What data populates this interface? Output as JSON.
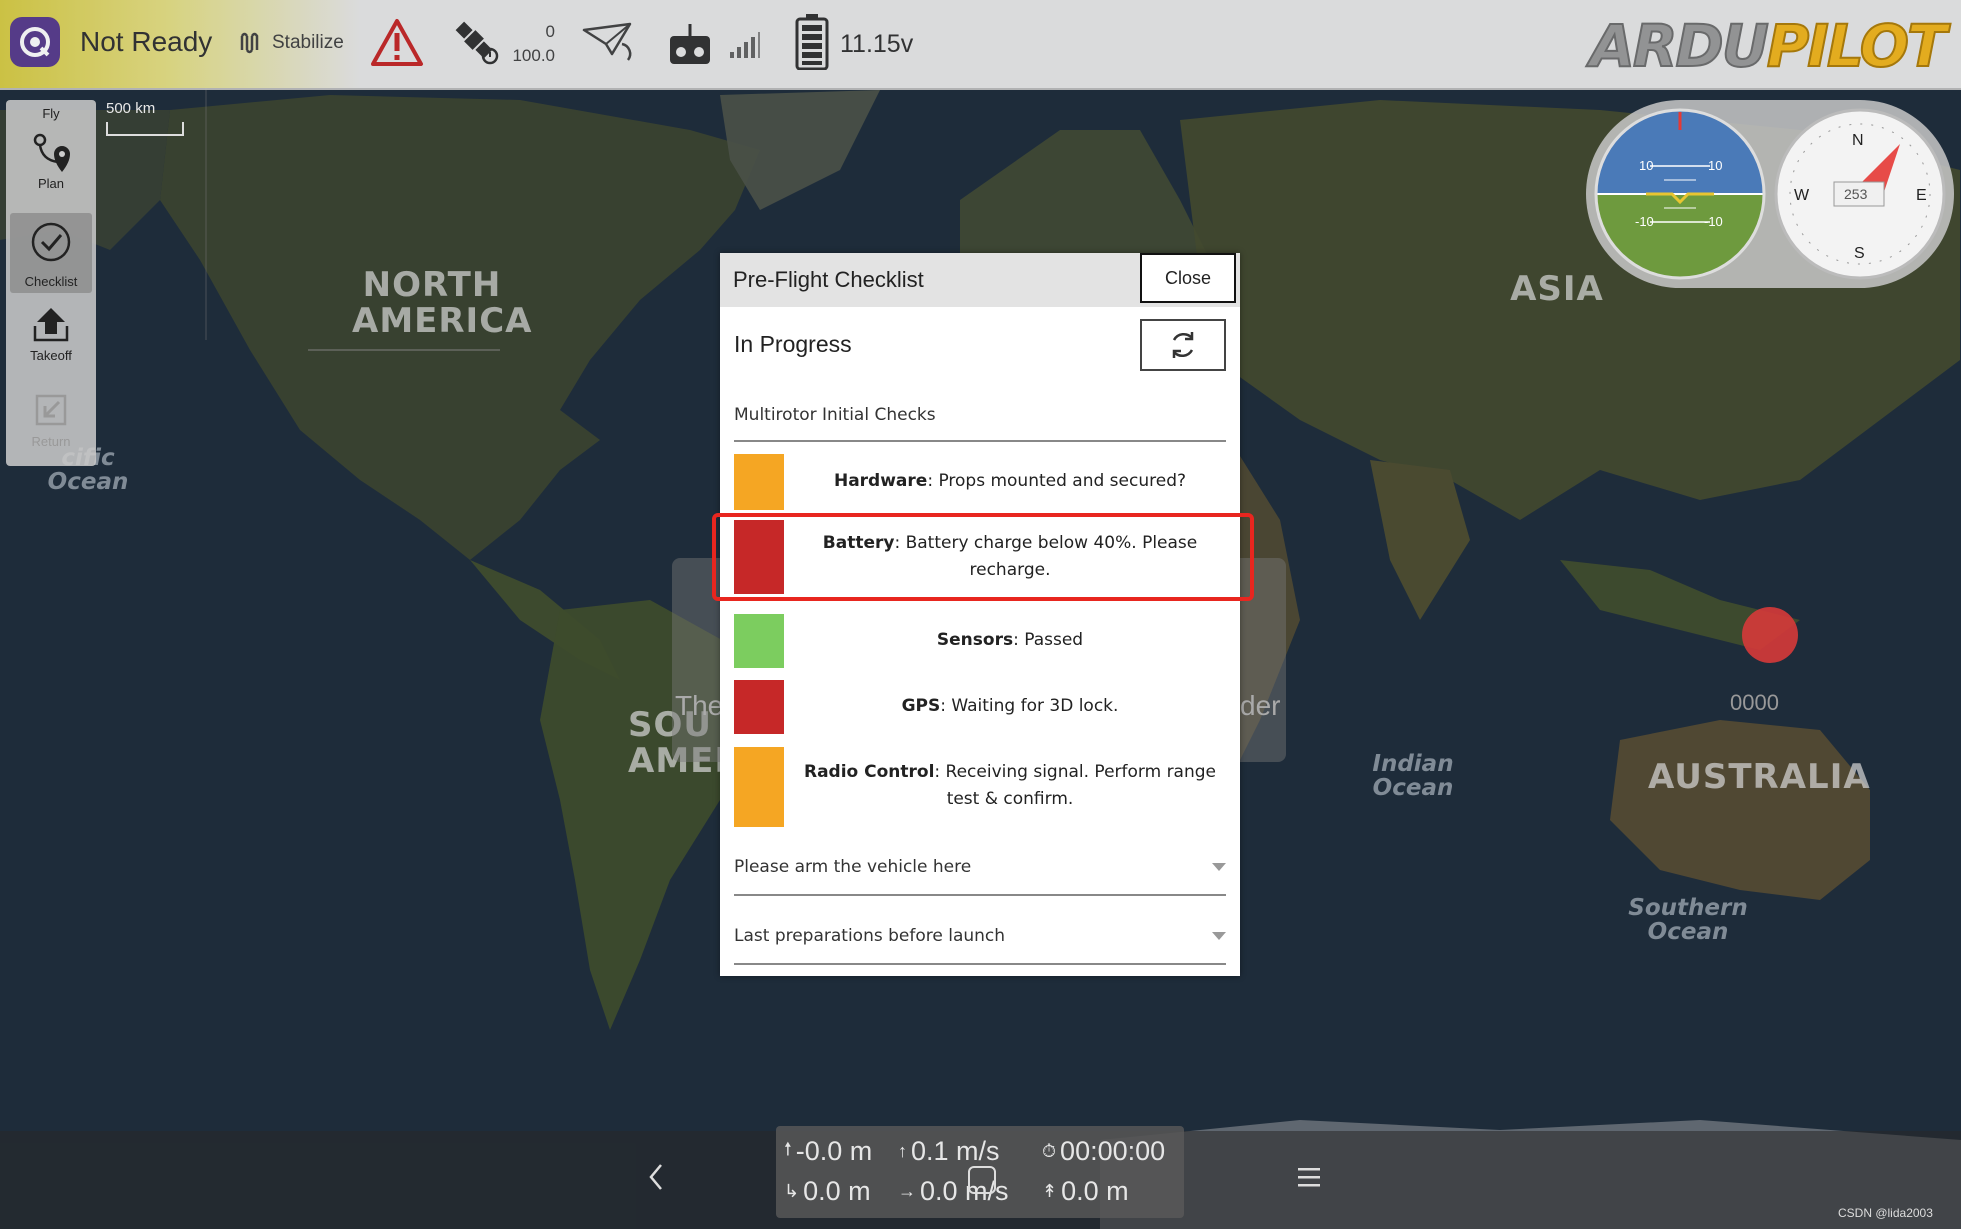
{
  "toolbar": {
    "status": "Not Ready",
    "flight_mode": "Stabilize",
    "gps_count": "0",
    "gps_hdop": "100.0",
    "battery_voltage": "11.15v",
    "brand_left": "ARDU",
    "brand_right": "PILOT"
  },
  "toolstrip": {
    "fly_label": "Fly",
    "items": [
      {
        "label": "Plan"
      },
      {
        "label": "Checklist"
      },
      {
        "label": "Takeoff"
      },
      {
        "label": "Return"
      }
    ]
  },
  "map": {
    "scale_label": "500 km",
    "labels": {
      "north_america": "NORTH\nAMERICA",
      "south_america": "SOU\nAMER",
      "asia": "ASIA",
      "australia": "AUSTRALIA",
      "pacific": "cific\nOcean",
      "indian": "Indian\nOcean",
      "southern": "Southern\nOcean"
    },
    "vehicle_marker_color": "#d63a3a",
    "vehicle_coord_fragment": "0000"
  },
  "instruments": {
    "pitch_labels": [
      "10",
      "10",
      "-10",
      "-10"
    ],
    "heading": "253",
    "compass": {
      "n": "N",
      "e": "E",
      "s": "S",
      "w": "W"
    }
  },
  "background_panel": {
    "left_fragment": "The",
    "right_fragment": "der"
  },
  "checklist": {
    "title": "Pre-Flight Checklist",
    "close_label": "Close",
    "progress": "In Progress",
    "group_title": "Multirotor Initial Checks",
    "items": [
      {
        "name": "Hardware",
        "text": ": Props mounted and secured?",
        "status_color": "#f5a623"
      },
      {
        "name": "Battery",
        "text": ": Battery charge below 40%. Please recharge.",
        "status_color": "#c62828"
      },
      {
        "name": "Sensors",
        "text": ": Passed",
        "status_color": "#7ccd5f"
      },
      {
        "name": "GPS",
        "text": ": Waiting for 3D lock.",
        "status_color": "#c62828"
      },
      {
        "name": "Radio Control",
        "text": ": Receiving signal. Perform range test & confirm.",
        "status_color": "#f5a623"
      }
    ],
    "dropdowns": [
      {
        "label": "Please arm the vehicle here"
      },
      {
        "label": "Last preparations before launch"
      }
    ]
  },
  "telemetry": {
    "altitude": "-0.0 m",
    "vertical_speed": "0.1 m/s",
    "flight_time": "00:00:00",
    "distance": "0.0 m",
    "ground_speed": "0.0 m/s",
    "home_distance": "0.0 m"
  },
  "watermark": "CSDN @lida2003"
}
